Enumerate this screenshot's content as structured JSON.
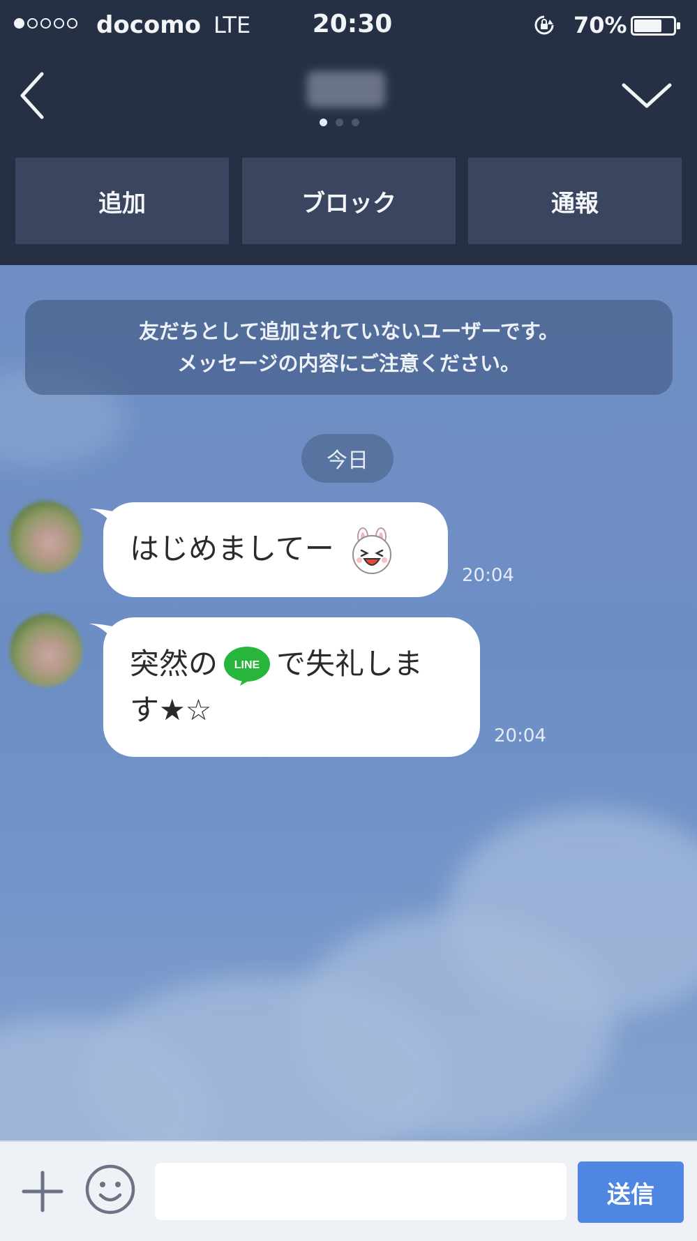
{
  "status_bar": {
    "carrier": "docomo",
    "network": "LTE",
    "time": "20:30",
    "battery_percent": "70%",
    "battery_level": 0.7,
    "signal_bars_filled": 1,
    "signal_bars_total": 5
  },
  "header": {
    "contact_name": "███",
    "page_indicator": {
      "count": 3,
      "active": 0
    },
    "icons": {
      "back": "back-arrow-icon",
      "menu": "chevron-down-icon"
    }
  },
  "actions": {
    "add_label": "追加",
    "block_label": "ブロック",
    "report_label": "通報"
  },
  "chat": {
    "notice_line1": "友だちとして追加されていないユーザーです。",
    "notice_line2": "メッセージの内容にご注意ください。",
    "date_label": "今日",
    "messages": [
      {
        "text": "はじめましてー",
        "emoji": "rabbit-face-emoji",
        "time": "20:04"
      },
      {
        "text_before": "突然の",
        "inline_icon": "line-logo-icon",
        "inline_icon_text": "LINE",
        "text_after_line1": "で失礼しま",
        "text_line2": "す★☆",
        "time": "20:04"
      }
    ]
  },
  "input_bar": {
    "placeholder": "",
    "value": "",
    "send_label": "送信",
    "icons": {
      "plus": "plus-icon",
      "emoji": "smiley-icon"
    }
  },
  "colors": {
    "header_bg": "#263045",
    "action_button_bg": "#3a4660",
    "chat_bg": "#6f8fc4",
    "bubble_bg": "#ffffff",
    "send_button": "#4f86e2",
    "line_green": "#27b63b"
  }
}
